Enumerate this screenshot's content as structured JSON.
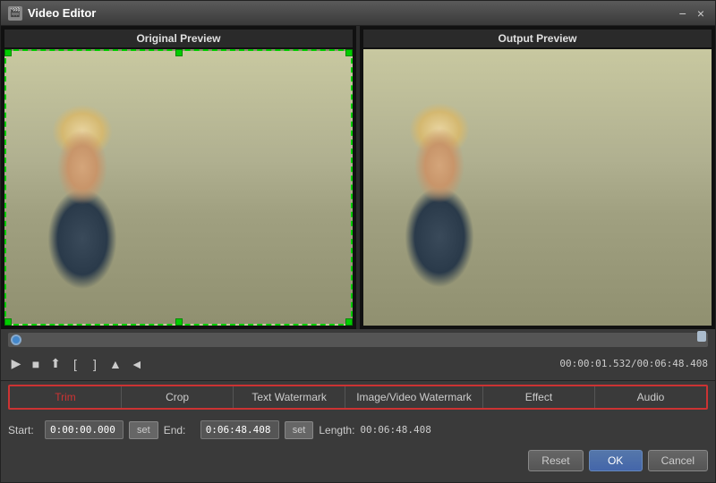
{
  "window": {
    "title": "Video Editor",
    "minimize_label": "−",
    "close_label": "×"
  },
  "preview": {
    "original_label": "Original Preview",
    "output_label": "Output Preview"
  },
  "timeline": {
    "time_display": "00:00:01.532/00:06:48.408"
  },
  "transport": {
    "play": "▶",
    "stop": "■",
    "export": "🔼",
    "mark_in": "[",
    "mark_out": "]",
    "split": "▲",
    "prev": "◄"
  },
  "tabs": [
    {
      "id": "trim",
      "label": "Trim",
      "active": true
    },
    {
      "id": "crop",
      "label": "Crop",
      "active": false
    },
    {
      "id": "text-watermark",
      "label": "Text Watermark",
      "active": false
    },
    {
      "id": "image-video-watermark",
      "label": "Image/Video Watermark",
      "active": false
    },
    {
      "id": "effect",
      "label": "Effect",
      "active": false
    },
    {
      "id": "audio",
      "label": "Audio",
      "active": false
    }
  ],
  "trim": {
    "start_label": "Start:",
    "start_value": "0:00:00.000",
    "set_label": "set",
    "end_label": "End:",
    "end_value": "0:06:48.408",
    "set2_label": "set",
    "length_label": "Length:",
    "length_value": "00:06:48.408"
  },
  "buttons": {
    "reset": "Reset",
    "ok": "OK",
    "cancel": "Cancel"
  }
}
